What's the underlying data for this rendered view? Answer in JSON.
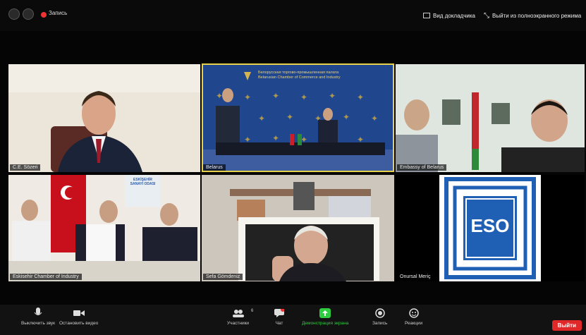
{
  "top_bar": {
    "record_label": "Запись",
    "view_button": "Вид докладчика",
    "exit_fullscreen": "Выйти из полноэкранного режима"
  },
  "tiles": [
    {
      "name": "C.E. Sözeri"
    },
    {
      "name": "Belarus",
      "banner_line1": "Белорусская торгово-промышленная палата",
      "banner_line2": "Belarusian Chamber of Commerce and Industry"
    },
    {
      "name": "Embassy of Belarus"
    },
    {
      "name": "Eskisehir Chamber of Industry",
      "logo_text": "ESKİŞEHİR SANAYİ ODASI"
    },
    {
      "name": "Sefa Gömdeniz"
    },
    {
      "name": "Onursal Meriç",
      "logo_text": "ESO"
    }
  ],
  "bottom_bar": {
    "mic": "Выключить звук",
    "video": "Остановить видео",
    "participants": "Участники",
    "participants_count": "6",
    "chat": "Чат",
    "share": "Демонстрация экрана",
    "record": "Запись",
    "reactions": "Реакции",
    "end": "Выйти"
  },
  "colors": {
    "accent_green": "#2ecc40",
    "end_red": "#e02828",
    "active_border": "#e8d14a",
    "eso_blue": "#1f5fb4"
  }
}
